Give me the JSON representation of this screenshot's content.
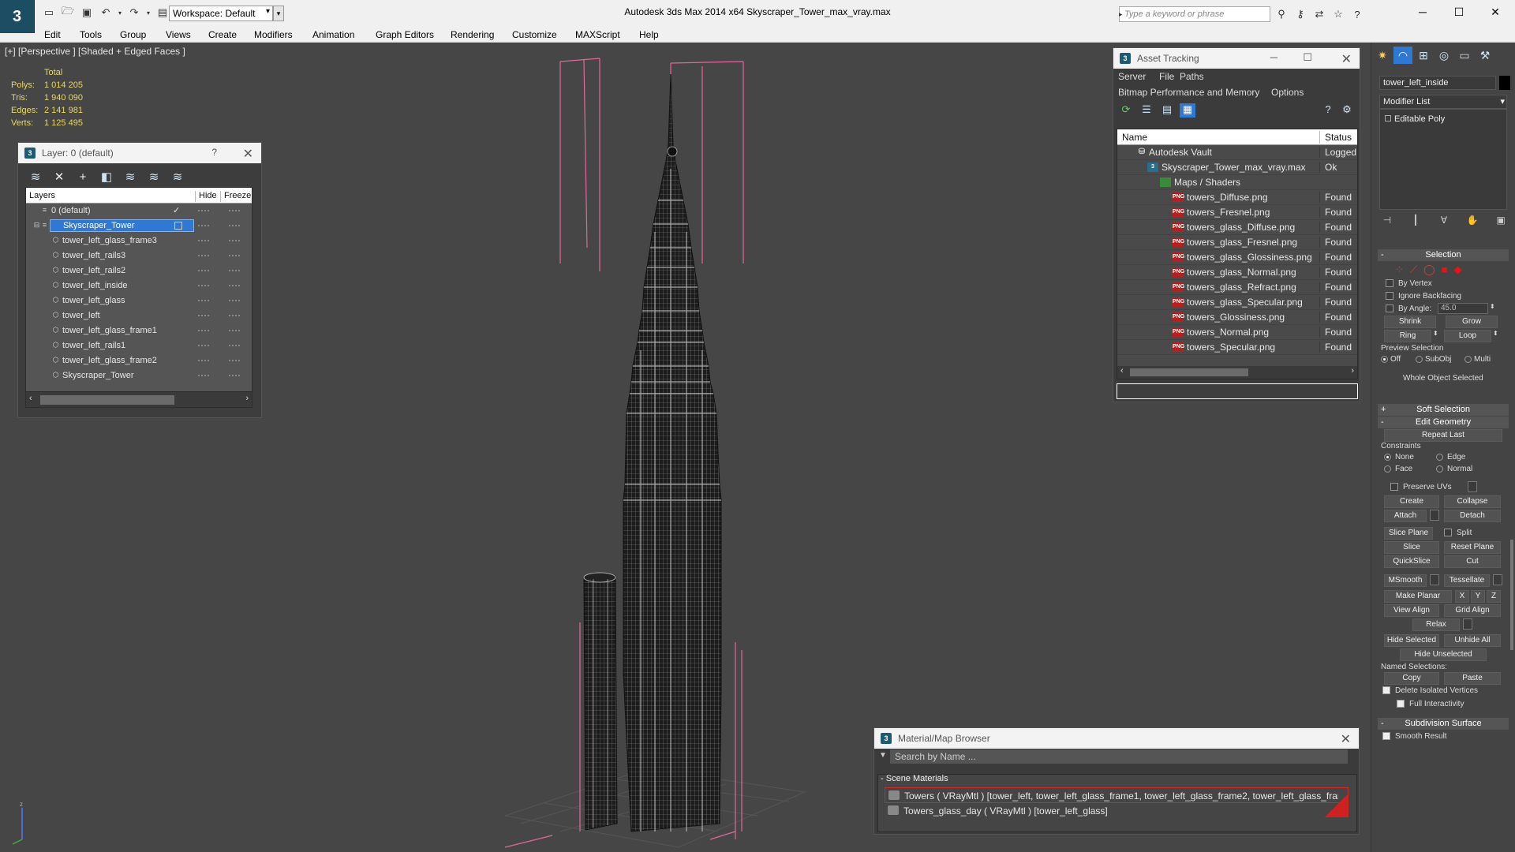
{
  "app": {
    "logo": "3",
    "title": "Autodesk 3ds Max  2014 x64      Skyscraper_Tower_max_vray.max",
    "workspace": "Workspace: Default",
    "search_placeholder": "Type a keyword or phrase"
  },
  "menu": [
    "Edit",
    "Tools",
    "Group",
    "Views",
    "Create",
    "Modifiers",
    "Animation",
    "Graph Editors",
    "Rendering",
    "Customize",
    "MAXScript",
    "Help"
  ],
  "viewport": {
    "label": "[+] [Perspective ] [Shaded + Edged Faces ]",
    "stats": {
      "header": "Total",
      "rows": [
        {
          "k": "Polys:",
          "v": "1 014 205"
        },
        {
          "k": "Tris:",
          "v": "1 940 090"
        },
        {
          "k": "Edges:",
          "v": "2 141 981"
        },
        {
          "k": "Verts:",
          "v": "1 125 495"
        }
      ]
    },
    "axis_z": "z"
  },
  "layer_panel": {
    "title": "Layer: 0 (default)",
    "help": "?",
    "columns": {
      "layers": "Layers",
      "hide": "Hide",
      "freeze": "Freeze"
    },
    "rows": [
      {
        "name": "0 (default)",
        "level": 0,
        "current": true
      },
      {
        "name": "Skyscraper_Tower",
        "level": 0,
        "selected": true
      },
      {
        "name": "tower_left_glass_frame3",
        "level": 1
      },
      {
        "name": "tower_left_rails3",
        "level": 1
      },
      {
        "name": "tower_left_rails2",
        "level": 1
      },
      {
        "name": "tower_left_inside",
        "level": 1
      },
      {
        "name": "tower_left_glass",
        "level": 1
      },
      {
        "name": "tower_left",
        "level": 1
      },
      {
        "name": "tower_left_glass_frame1",
        "level": 1
      },
      {
        "name": "tower_left_rails1",
        "level": 1
      },
      {
        "name": "tower_left_glass_frame2",
        "level": 1
      },
      {
        "name": "Skyscraper_Tower",
        "level": 1
      }
    ]
  },
  "asset_panel": {
    "title": "Asset Tracking",
    "menu1": [
      "Server",
      "File",
      "Paths"
    ],
    "menu2": [
      "Bitmap Performance and Memory",
      "Options"
    ],
    "columns": {
      "name": "Name",
      "status": "Status"
    },
    "rows": [
      {
        "name": "Autodesk Vault",
        "status": "Logged O",
        "level": 1,
        "icon": "vault"
      },
      {
        "name": "Skyscraper_Tower_max_vray.max",
        "status": "Ok",
        "level": 2,
        "icon": "max"
      },
      {
        "name": "Maps / Shaders",
        "status": "",
        "level": 3,
        "icon": "folder"
      },
      {
        "name": "towers_Diffuse.png",
        "status": "Found",
        "level": 4,
        "icon": "png"
      },
      {
        "name": "towers_Fresnel.png",
        "status": "Found",
        "level": 4,
        "icon": "png"
      },
      {
        "name": "towers_glass_Diffuse.png",
        "status": "Found",
        "level": 4,
        "icon": "png"
      },
      {
        "name": "towers_glass_Fresnel.png",
        "status": "Found",
        "level": 4,
        "icon": "png"
      },
      {
        "name": "towers_glass_Glossiness.png",
        "status": "Found",
        "level": 4,
        "icon": "png"
      },
      {
        "name": "towers_glass_Normal.png",
        "status": "Found",
        "level": 4,
        "icon": "png"
      },
      {
        "name": "towers_glass_Refract.png",
        "status": "Found",
        "level": 4,
        "icon": "png"
      },
      {
        "name": "towers_glass_Specular.png",
        "status": "Found",
        "level": 4,
        "icon": "png"
      },
      {
        "name": "towers_Glossiness.png",
        "status": "Found",
        "level": 4,
        "icon": "png"
      },
      {
        "name": "towers_Normal.png",
        "status": "Found",
        "level": 4,
        "icon": "png"
      },
      {
        "name": "towers_Specular.png",
        "status": "Found",
        "level": 4,
        "icon": "png"
      }
    ]
  },
  "material_panel": {
    "title": "Material/Map Browser",
    "search_placeholder": "Search by Name ...",
    "group": "Scene Materials",
    "items": [
      "Towers  ( VRayMtl ) [tower_left, tower_left_glass_frame1, tower_left_glass_frame2, tower_left_glass_frame...",
      "Towers_glass_day  ( VRayMtl ) [tower_left_glass]"
    ]
  },
  "command_panel": {
    "object_name": "tower_left_inside",
    "modifier_list": "Modifier List",
    "stack": [
      "Editable Poly"
    ],
    "selection": {
      "title": "Selection",
      "by_vertex": "By Vertex",
      "ignore_backfacing": "Ignore Backfacing",
      "by_angle": "By Angle:",
      "angle_value": "45.0",
      "shrink": "Shrink",
      "grow": "Grow",
      "ring": "Ring",
      "loop": "Loop",
      "preview": "Preview Selection",
      "off": "Off",
      "subobj": "SubObj",
      "multi": "Multi",
      "status": "Whole Object Selected"
    },
    "soft_selection": "Soft Selection",
    "edit_geometry": {
      "title": "Edit Geometry",
      "repeat_last": "Repeat Last",
      "constraints": "Constraints",
      "none": "None",
      "edge": "Edge",
      "face": "Face",
      "normal": "Normal",
      "preserve_uvs": "Preserve UVs",
      "create": "Create",
      "collapse": "Collapse",
      "attach": "Attach",
      "detach": "Detach",
      "slice_plane": "Slice Plane",
      "split": "Split",
      "slice": "Slice",
      "reset_plane": "Reset Plane",
      "quickslice": "QuickSlice",
      "cut": "Cut",
      "msmooth": "MSmooth",
      "tessellate": "Tessellate",
      "make_planar": "Make Planar",
      "x": "X",
      "y": "Y",
      "z": "Z",
      "view_align": "View Align",
      "grid_align": "Grid Align",
      "relax": "Relax",
      "hide_selected": "Hide Selected",
      "unhide_all": "Unhide All",
      "hide_unselected": "Hide Unselected",
      "named_selections": "Named Selections:",
      "copy": "Copy",
      "paste": "Paste",
      "delete_isolated": "Delete Isolated Vertices",
      "full_interactivity": "Full Interactivity"
    },
    "subdivision_surface": "Subdivision Surface",
    "smooth_result": "Smooth Result"
  },
  "colors": {
    "viewport_bg": "#464646",
    "stats_text": "#e8d860",
    "selection_blue": "#2f79d4",
    "bbox_pink": "#e0689a"
  }
}
